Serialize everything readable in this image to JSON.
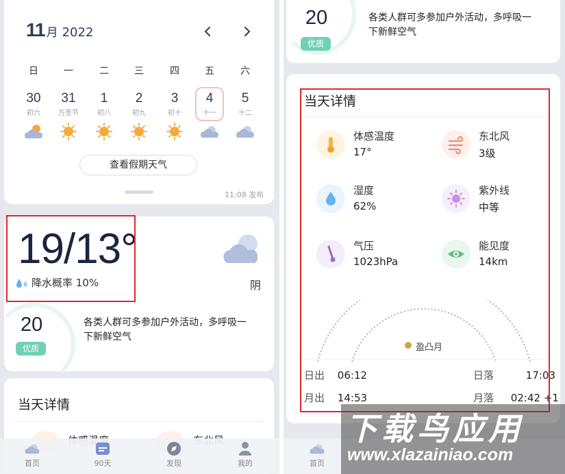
{
  "calendar": {
    "month_day": "11",
    "month_suffix": "月",
    "year": "2022",
    "weekdays": [
      "日",
      "一",
      "二",
      "三",
      "四",
      "五",
      "六"
    ],
    "days": [
      {
        "num": "30",
        "sub": "初六",
        "icon": "partly-cloudy-icon"
      },
      {
        "num": "31",
        "sub": "万圣节",
        "icon": "sun-icon"
      },
      {
        "num": "1",
        "sub": "初八",
        "icon": "sun-icon"
      },
      {
        "num": "2",
        "sub": "初九",
        "icon": "sun-icon"
      },
      {
        "num": "3",
        "sub": "初十",
        "icon": "sun-icon"
      },
      {
        "num": "4",
        "sub": "十一",
        "icon": "cloud-icon",
        "today": true
      },
      {
        "num": "5",
        "sub": "十二",
        "icon": "cloud-icon"
      }
    ],
    "holiday_button": "查看假期天气",
    "publish_time": "11:08 发布"
  },
  "current": {
    "temp_range": "19/13°",
    "rain_label": "降水概率 10%",
    "condition": "阴"
  },
  "aqi": {
    "value": "20",
    "level": "优质",
    "advice": "各类人群可多参加户外活动，多呼吸一下新鲜空气"
  },
  "details": {
    "title": "当天详情",
    "items": [
      {
        "label": "体感温度",
        "value": "17°",
        "icon": "thermometer-icon"
      },
      {
        "label": "东北风",
        "value": "3级",
        "icon": "wind-icon"
      },
      {
        "label": "湿度",
        "value": "62%",
        "icon": "humidity-drop-icon"
      },
      {
        "label": "紫外线",
        "value": "中等",
        "icon": "uv-sun-icon"
      },
      {
        "label": "气压",
        "value": "1023hPa",
        "icon": "barometer-icon"
      },
      {
        "label": "能见度",
        "value": "14km",
        "icon": "eye-icon"
      }
    ],
    "moon_phase": "盈凸月",
    "sunrise_label": "日出",
    "sunrise": "06:12",
    "sunset_label": "日落",
    "sunset": "17:03",
    "moonrise_label": "月出",
    "moonrise": "14:53",
    "moonset_label": "月落",
    "moonset": "02:42 +1"
  },
  "tabs": [
    {
      "label": "首页",
      "icon": "home-cloud-icon"
    },
    {
      "label": "90天",
      "icon": "calendar-icon"
    },
    {
      "label": "发现",
      "icon": "compass-icon"
    },
    {
      "label": "我的",
      "icon": "user-icon"
    }
  ],
  "watermark": {
    "brand": "下载鸟应用",
    "url": "www.xlazainiao.com"
  },
  "colors": {
    "highlight_border": "#e0262b",
    "aqi_badge": "#6fd0b4",
    "today_border": "#f3c2bc",
    "sun": "#f7a93b",
    "cloud": "#a9b8d8"
  }
}
